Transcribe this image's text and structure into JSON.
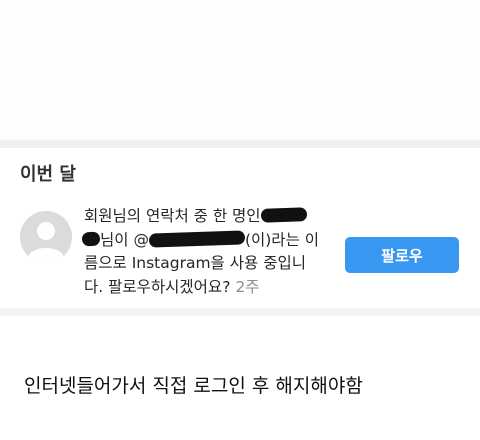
{
  "section": {
    "title": "이번 달"
  },
  "notification": {
    "line1": "회원님의 연락처 중 한 명인",
    "line2_suffix": "님이 @",
    "line2_tail": "(이)라는 이",
    "line3": "름으로 Instagram을 사용 중입니",
    "line4": "다. 팔로우하시겠어요?",
    "time": "2주",
    "follow_label": "팔로우"
  },
  "caption": {
    "text": "인터넷들어가서 직접 로그인 후 해지해야함"
  },
  "colors": {
    "follow_button": "#3897f0",
    "timestamp": "#8e8e8e",
    "avatar": "#dbdbdb"
  }
}
